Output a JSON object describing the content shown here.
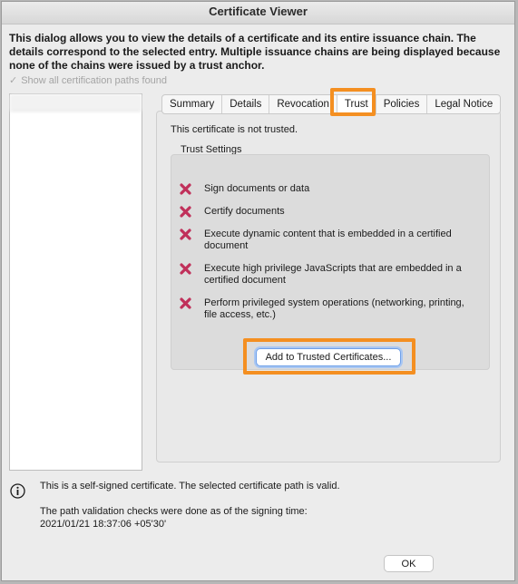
{
  "window": {
    "title": "Certificate Viewer"
  },
  "intro": "This dialog allows you to view the details of a certificate and its entire issuance chain. The details correspond to the selected entry. Multiple issuance chains are being displayed because none of the chains were issued by a trust anchor.",
  "show_all": {
    "label": "Show all certification paths found",
    "checked": true,
    "enabled": false
  },
  "tabs": [
    {
      "label": "Summary",
      "active": false
    },
    {
      "label": "Details",
      "active": false
    },
    {
      "label": "Revocation",
      "active": false
    },
    {
      "label": "Trust",
      "active": true
    },
    {
      "label": "Policies",
      "active": false
    },
    {
      "label": "Legal Notice",
      "active": false
    }
  ],
  "trust": {
    "status": "This certificate is not trusted.",
    "settings_label": "Trust Settings",
    "permissions": [
      {
        "label": "Sign documents or data",
        "allowed": false
      },
      {
        "label": "Certify documents",
        "allowed": false
      },
      {
        "label": "Execute dynamic content that is embedded in a certified document",
        "allowed": false
      },
      {
        "label": "Execute high privilege JavaScripts that are embedded in a certified document",
        "allowed": false
      },
      {
        "label": "Perform privileged system operations (networking, printing, file access, etc.)",
        "allowed": false
      }
    ],
    "add_button": "Add to Trusted Certificates..."
  },
  "info": {
    "line1": "This is a self-signed certificate. The selected certificate path is valid.",
    "line2": "The path validation checks were done as of the signing time:",
    "line3": "2021/01/21 18:37:06 +05'30'"
  },
  "ok_button": "OK",
  "colors": {
    "highlight": "#f48f21",
    "x_mark": "#c0305a",
    "focus_ring": "#6fa0e9"
  },
  "icons": {
    "permission_denied": "x-mark-icon",
    "info": "info-icon",
    "checkbox": "checkmark-icon"
  }
}
